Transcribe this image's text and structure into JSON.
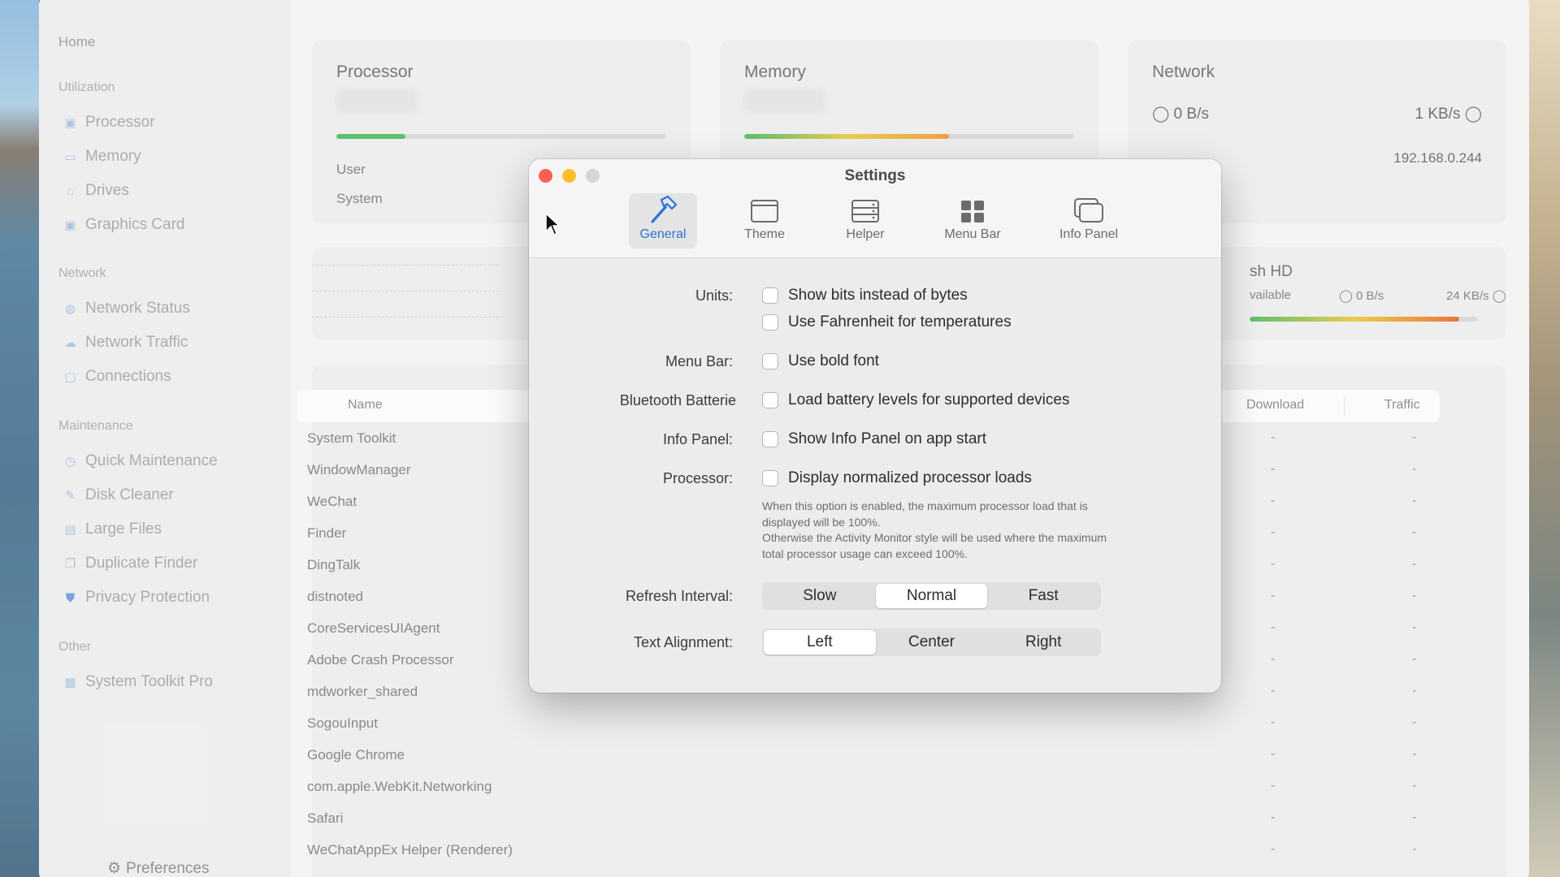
{
  "sidebar": {
    "home": "Home",
    "sections": {
      "utilization": "Utilization",
      "network": "Network",
      "maintenance": "Maintenance",
      "other": "Other"
    },
    "utilization_items": [
      "Processor",
      "Memory",
      "Drives",
      "Graphics Card"
    ],
    "network_items": [
      "Network Status",
      "Network Traffic",
      "Connections"
    ],
    "maintenance_items": [
      "Quick Maintenance",
      "Disk Cleaner",
      "Large Files",
      "Duplicate Finder",
      "Privacy Protection"
    ],
    "other_items": [
      "System Toolkit Pro"
    ],
    "preferences": "Preferences"
  },
  "cards": {
    "processor": {
      "title": "Processor",
      "user_label": "User",
      "system_label": "System",
      "usage_fraction": 0.21
    },
    "memory": {
      "title": "Memory",
      "usage_fraction": 0.62
    },
    "network": {
      "title": "Network",
      "upload": "0 B/s",
      "download": "1 KB/s",
      "local_ip": "192.168.0.244"
    },
    "drive": {
      "title": "sh HD",
      "available": "vailable",
      "read": "0 B/s",
      "write": "24 KB/s",
      "usage_fraction": 0.92
    }
  },
  "table": {
    "columns": {
      "name": "Name",
      "download": "Download",
      "traffic": "Traffic"
    },
    "rows": [
      "System Toolkit",
      "WindowManager",
      "WeChat",
      "Finder",
      "DingTalk",
      "distnoted",
      "CoreServicesUIAgent",
      "Adobe Crash Processor",
      "mdworker_shared",
      "SogouInput",
      "Google Chrome",
      "com.apple.WebKit.Networking",
      "Safari",
      "WeChatAppEx Helper (Renderer)"
    ],
    "dash": "-"
  },
  "settings": {
    "title": "Settings",
    "tabs": [
      "General",
      "Theme",
      "Helper",
      "Menu Bar",
      "Info Panel"
    ],
    "active_tab": "General",
    "labels": {
      "units": "Units:",
      "menu_bar": "Menu Bar:",
      "bluetooth": "Bluetooth Batterie",
      "info_panel": "Info Panel:",
      "processor": "Processor:",
      "refresh": "Refresh Interval:",
      "alignment": "Text Alignment:"
    },
    "options": {
      "bits": "Show bits instead of bytes",
      "fahrenheit": "Use Fahrenheit for temperatures",
      "bold": "Use bold font",
      "battery": "Load battery levels for supported devices",
      "info_start": "Show Info Panel on app start",
      "normalized": "Display normalized processor loads"
    },
    "note_line1": "When this option is enabled, the maximum processor load that is",
    "note_line2": "displayed will be 100%.",
    "note_line3": "Otherwise the Activity Monitor style will be used where the maximum",
    "note_line4": "total processor usage can exceed 100%.",
    "refresh_options": [
      "Slow",
      "Normal",
      "Fast"
    ],
    "refresh_selected": "Normal",
    "alignment_options": [
      "Left",
      "Center",
      "Right"
    ],
    "alignment_selected": "Left"
  },
  "colors": {
    "accent": "#2a74d8",
    "close": "#ff5f57",
    "minimize": "#febc2e",
    "zoom_inactive": "#d5d5d5"
  }
}
